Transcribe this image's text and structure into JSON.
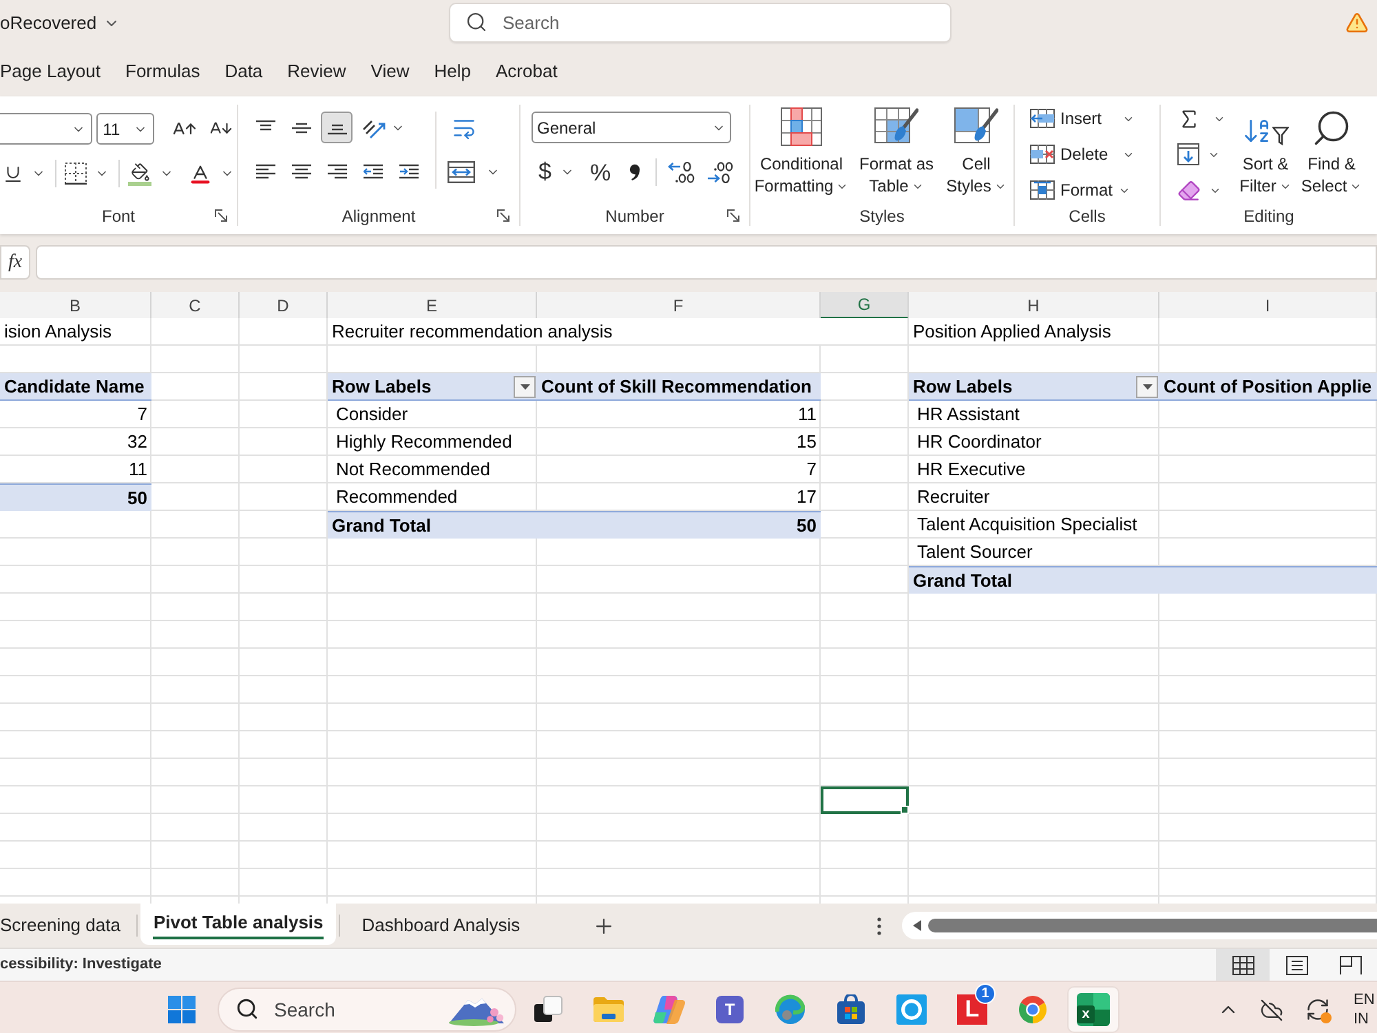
{
  "title_bar": {
    "file_name": "oRecovered",
    "search": {
      "placeholder": "Search"
    }
  },
  "menu_tabs": [
    "Page Layout",
    "Formulas",
    "Data",
    "Review",
    "View",
    "Help",
    "Acrobat"
  ],
  "ribbon": {
    "font": {
      "label": "Font",
      "size": "11"
    },
    "alignment": {
      "label": "Alignment",
      "vertical": [
        {
          "kind": "top",
          "selected": false
        },
        {
          "kind": "middle",
          "selected": false
        },
        {
          "kind": "bottom",
          "selected": true
        }
      ]
    },
    "number": {
      "label": "Number",
      "format": "General",
      "currency": "$",
      "percent": "%"
    },
    "styles": {
      "label": "Styles",
      "buttons": [
        {
          "kind": "conditional",
          "label": "Conditional Formatting"
        },
        {
          "kind": "table",
          "label": "Format as Table"
        },
        {
          "kind": "cell",
          "label": "Cell Styles"
        }
      ]
    },
    "cells": {
      "label": "Cells",
      "buttons": [
        {
          "kind": "insert",
          "label": "Insert"
        },
        {
          "kind": "delete",
          "label": "Delete"
        },
        {
          "kind": "format",
          "label": "Format"
        }
      ]
    },
    "editing": {
      "label": "Editing",
      "buttons": [
        {
          "kind": "sort",
          "label": "Sort & Filter"
        },
        {
          "kind": "find",
          "label": "Find & Select"
        }
      ]
    }
  },
  "formula_bar": {
    "label": "fx"
  },
  "sheet": {
    "columns": [
      {
        "label": "B",
        "selected": false
      },
      {
        "label": "C",
        "selected": false
      },
      {
        "label": "D",
        "selected": false
      },
      {
        "label": "E",
        "selected": false
      },
      {
        "label": "F",
        "selected": false
      },
      {
        "label": "G",
        "selected": true
      },
      {
        "label": "H",
        "selected": false
      },
      {
        "label": "I",
        "selected": false
      }
    ],
    "rows": [
      [
        {
          "kind": "title",
          "text": "ision Analysis",
          "selected": false
        },
        null,
        null,
        {
          "kind": "title",
          "text": "Recruiter recommendation analysis",
          "selected": false
        },
        null,
        null,
        {
          "kind": "title",
          "text": "Position Applied Analysis",
          "selected": false
        },
        null
      ],
      [
        null,
        null,
        null,
        null,
        null,
        null,
        null,
        null
      ],
      [
        {
          "kind": "header",
          "text": "Candidate Name",
          "selected": false
        },
        null,
        null,
        {
          "kind": "row_labels",
          "text": "Row Labels",
          "selected": false
        },
        {
          "kind": "header",
          "text": "Count of Skill Recommendation",
          "selected": false
        },
        null,
        {
          "kind": "row_labels",
          "text": "Row Labels",
          "selected": false
        },
        {
          "kind": "header",
          "text": "Count of Position Applie",
          "selected": false
        }
      ],
      [
        {
          "kind": "value",
          "text": "7",
          "selected": false
        },
        null,
        null,
        {
          "kind": "item",
          "text": "Consider",
          "selected": false
        },
        {
          "kind": "value",
          "text": "11",
          "selected": false
        },
        null,
        {
          "kind": "item",
          "text": "HR Assistant",
          "selected": false
        },
        null
      ],
      [
        {
          "kind": "value",
          "text": "32",
          "selected": false
        },
        null,
        null,
        {
          "kind": "item",
          "text": "Highly Recommended",
          "selected": false
        },
        {
          "kind": "value",
          "text": "15",
          "selected": false
        },
        null,
        {
          "kind": "item",
          "text": "HR Coordinator",
          "selected": false
        },
        null
      ],
      [
        {
          "kind": "value",
          "text": "11",
          "selected": false
        },
        null,
        null,
        {
          "kind": "item",
          "text": "Not Recommended",
          "selected": false
        },
        {
          "kind": "value",
          "text": "7",
          "selected": false
        },
        null,
        {
          "kind": "item",
          "text": "HR Executive",
          "selected": false
        },
        null
      ],
      [
        {
          "kind": "total_value",
          "text": "50",
          "selected": false
        },
        null,
        null,
        {
          "kind": "item",
          "text": "Recommended",
          "selected": false
        },
        {
          "kind": "value",
          "text": "17",
          "selected": false
        },
        null,
        {
          "kind": "item",
          "text": "Recruiter",
          "selected": false
        },
        null
      ],
      [
        null,
        null,
        null,
        {
          "kind": "total_label",
          "text": "Grand Total",
          "selected": false
        },
        {
          "kind": "total_value",
          "text": "50",
          "selected": false
        },
        null,
        {
          "kind": "item",
          "text": "Talent Acquisition Specialist",
          "selected": false
        },
        null
      ],
      [
        null,
        null,
        null,
        null,
        null,
        null,
        {
          "kind": "item",
          "text": "Talent Sourcer",
          "selected": false
        },
        null
      ],
      [
        null,
        null,
        null,
        null,
        null,
        null,
        {
          "kind": "total_label",
          "text": "Grand Total",
          "selected": false
        },
        {
          "kind": "total",
          "selected": false
        }
      ],
      [
        null,
        null,
        null,
        null,
        null,
        null,
        null,
        null
      ],
      [
        null,
        null,
        null,
        null,
        null,
        null,
        null,
        null
      ],
      [
        null,
        null,
        null,
        null,
        null,
        null,
        null,
        null
      ],
      [
        null,
        null,
        null,
        null,
        null,
        null,
        null,
        null
      ],
      [
        null,
        null,
        null,
        null,
        null,
        null,
        null,
        null
      ],
      [
        null,
        null,
        null,
        null,
        null,
        null,
        null,
        null
      ],
      [
        null,
        null,
        null,
        null,
        null,
        null,
        null,
        null
      ],
      [
        null,
        null,
        null,
        null,
        null,
        {
          "selected": true
        },
        null,
        null
      ],
      [
        null,
        null,
        null,
        null,
        null,
        null,
        null,
        null
      ],
      [
        null,
        null,
        null,
        null,
        null,
        null,
        null,
        null
      ],
      [
        null,
        null,
        null,
        null,
        null,
        null,
        null,
        null
      ]
    ]
  },
  "sheet_tabs": [
    {
      "label": "Screening data",
      "selected": false
    },
    {
      "label": "Pivot Table analysis",
      "selected": true
    },
    {
      "label": "Dashboard Analysis",
      "selected": false
    }
  ],
  "status_bar": {
    "text": "cessibility: Investigate",
    "views": [
      {
        "kind": "normal",
        "selected": true
      },
      {
        "kind": "page_layout",
        "selected": false
      },
      {
        "kind": "page_break",
        "selected": false
      }
    ]
  },
  "taskbar": {
    "search": {
      "placeholder": "Search"
    },
    "apps": [
      {
        "kind": "task_view",
        "selected": false
      },
      {
        "kind": "folder",
        "selected": false
      },
      {
        "kind": "swirl",
        "selected": false
      },
      {
        "kind": "people",
        "mark": "T",
        "selected": false
      },
      {
        "kind": "wave",
        "selected": false
      },
      {
        "kind": "bag",
        "selected": false
      },
      {
        "kind": "ring",
        "selected": false
      },
      {
        "kind": "letter",
        "mark": "L",
        "badge": "1",
        "selected": false
      },
      {
        "kind": "tricolor",
        "selected": false
      },
      {
        "kind": "sheet",
        "mark": "x",
        "selected": true
      }
    ],
    "language": [
      "EN",
      "IN"
    ]
  }
}
